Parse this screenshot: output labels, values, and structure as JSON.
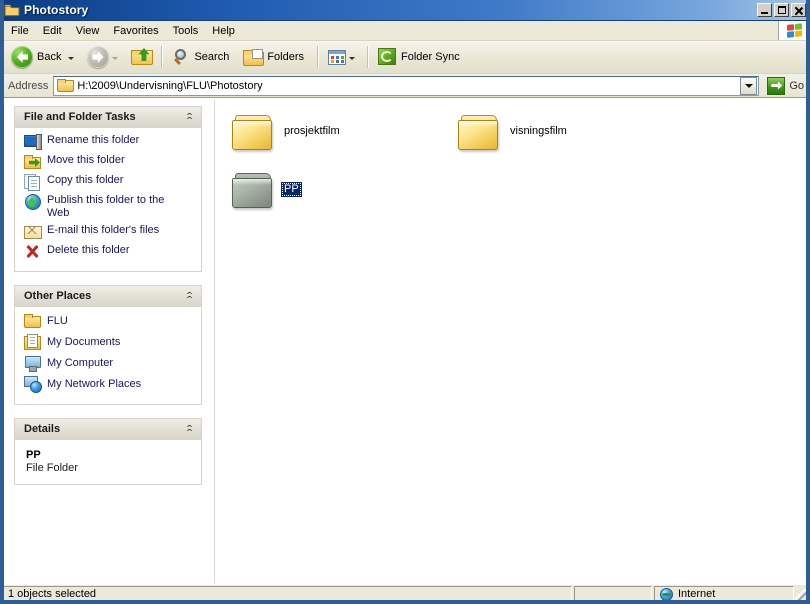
{
  "window": {
    "title": "Photostory",
    "title_icon": "folder-icon",
    "buttons": {
      "minimize": "minimize-button",
      "maximize": "maximize-button",
      "close": "close-button"
    }
  },
  "menubar": {
    "items": [
      {
        "label": "File"
      },
      {
        "label": "Edit"
      },
      {
        "label": "View"
      },
      {
        "label": "Favorites"
      },
      {
        "label": "Tools"
      },
      {
        "label": "Help"
      }
    ],
    "brand_icon": "windows-flag-icon"
  },
  "toolbar": {
    "back_label": "Back",
    "back_icon": "back-arrow-icon",
    "forward_icon": "forward-arrow-icon",
    "up_icon": "up-folder-icon",
    "search_label": "Search",
    "search_icon": "search-icon",
    "folders_label": "Folders",
    "folders_icon": "folders-icon",
    "views_icon": "views-icon",
    "folder_sync_label": "Folder Sync",
    "folder_sync_icon": "folder-sync-icon"
  },
  "address": {
    "label": "Address",
    "path": "H:\\2009\\Undervisning\\FLU\\Photostory",
    "folder_icon": "folder-icon",
    "dropdown_icon": "chevron-down-icon",
    "go_label": "Go",
    "go_icon": "go-arrow-icon"
  },
  "sidebar": {
    "panels": [
      {
        "title": "File and Folder Tasks",
        "collapse_icon": "chevron-up-icon",
        "items": [
          {
            "label": "Rename this folder",
            "icon": "rename-icon"
          },
          {
            "label": "Move this folder",
            "icon": "move-icon"
          },
          {
            "label": "Copy this folder",
            "icon": "copy-icon"
          },
          {
            "label": "Publish this folder to the Web",
            "icon": "publish-web-icon"
          },
          {
            "label": "E-mail this folder's files",
            "icon": "email-icon"
          },
          {
            "label": "Delete this folder",
            "icon": "delete-icon"
          }
        ]
      },
      {
        "title": "Other Places",
        "collapse_icon": "chevron-up-icon",
        "items": [
          {
            "label": "FLU",
            "icon": "folder-icon"
          },
          {
            "label": "My Documents",
            "icon": "my-documents-icon"
          },
          {
            "label": "My Computer",
            "icon": "my-computer-icon"
          },
          {
            "label": "My Network Places",
            "icon": "my-network-places-icon"
          }
        ]
      }
    ],
    "details": {
      "title": "Details",
      "collapse_icon": "chevron-up-icon",
      "name": "PP",
      "type": "File Folder"
    }
  },
  "filepane": {
    "items": [
      {
        "label": "prosjektfilm",
        "icon": "folder-icon",
        "selected": false
      },
      {
        "label": "visningsfilm",
        "icon": "folder-icon",
        "selected": false
      },
      {
        "label": "PP",
        "icon": "folder-icon",
        "selected": true
      }
    ]
  },
  "statusbar": {
    "status_text": "1 objects selected",
    "middle_text": "",
    "zone_text": "Internet",
    "zone_icon": "globe-icon"
  },
  "colors": {
    "title_bar_blue": "#1f5bb0",
    "window_border": "#2f5d96",
    "toolbar_bg": "#ece9d8",
    "link_text": "#15156b",
    "selection_blue": "#0a246a",
    "folder_yellow": "#f3cc56"
  }
}
